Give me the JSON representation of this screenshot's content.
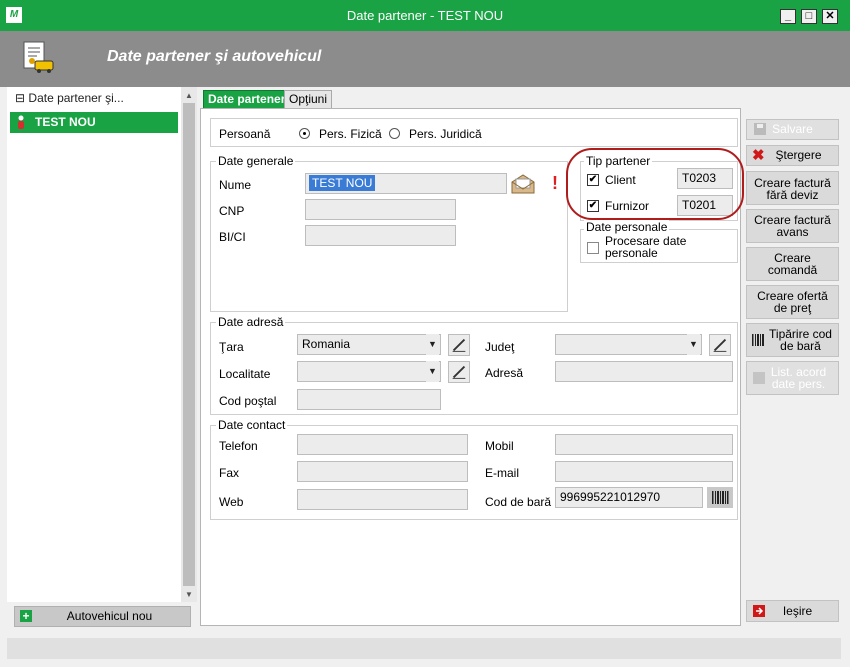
{
  "window": {
    "title": "Date partener - TEST NOU",
    "logo_text": "M",
    "minimize": "_",
    "maximize": "□",
    "close": "✕"
  },
  "header": {
    "title": "Date partener şi autovehicul"
  },
  "tree": {
    "root_label": "Date partener şi...",
    "root_toggle": "⊟",
    "selected_label": "TEST NOU"
  },
  "left_footer": {
    "add_vehicle_label": "Autovehicul nou",
    "plus": "+"
  },
  "tabs": [
    {
      "label": "Date partener"
    },
    {
      "label": "Opţiuni"
    }
  ],
  "persoana": {
    "label": "Persoană",
    "options": [
      "Pers. Fizică",
      "Pers. Juridică"
    ],
    "selected": "Pers. Fizică"
  },
  "date_generale": {
    "legend": "Date generale",
    "nume_label": "Nume",
    "nume_value": "TEST NOU",
    "cnp_label": "CNP",
    "cnp_value": "",
    "bici_label": "BI/CI",
    "bici_value": "",
    "warning": "!"
  },
  "tip_partener": {
    "legend": "Tip partener",
    "client_label": "Client",
    "client_checked": true,
    "client_code": "T0203",
    "furnizor_label": "Furnizor",
    "furnizor_checked": true,
    "furnizor_code": "T0201",
    "check_mark": "✔"
  },
  "date_personale": {
    "legend": "Date personale",
    "procesare_label_1": "Procesare date",
    "procesare_label_2": "personale",
    "procesare_checked": false
  },
  "date_adresa": {
    "legend": "Date adresă",
    "tara_label": "Ţara",
    "tara_value": "Romania",
    "judet_label": "Judeţ",
    "judet_value": "",
    "localitate_label": "Localitate",
    "localitate_value": "",
    "adresa_label": "Adresă",
    "adresa_value": "",
    "cod_postal_label": "Cod poştal",
    "cod_postal_value": "",
    "dropdown_arrow": "▼"
  },
  "date_contact": {
    "legend": "Date contact",
    "telefon_label": "Telefon",
    "fax_label": "Fax",
    "web_label": "Web",
    "mobil_label": "Mobil",
    "email_label": "E-mail",
    "cod_bara_label": "Cod de bară",
    "cod_bara_value": "996995221012970"
  },
  "actions": {
    "salvare": "Salvare",
    "stergere": "Ştergere",
    "factura_fara_deviz_1": "Creare factură",
    "factura_fara_deviz_2": "fără deviz",
    "factura_avans_1": "Creare factură",
    "factura_avans_2": "avans",
    "comanda_1": "Creare",
    "comanda_2": "comandă",
    "oferta_1": "Creare ofertă",
    "oferta_2": "de preţ",
    "tiparire_1": "Tipărire cod",
    "tiparire_2": "de bară",
    "acord_1": "List. acord",
    "acord_2": "date pers.",
    "iesire": "Ieşire",
    "x_mark": "✖"
  },
  "colors": {
    "accent": "#1aa345",
    "header_gray": "#8c8c8c",
    "highlight_circle": "#b01c1c"
  }
}
